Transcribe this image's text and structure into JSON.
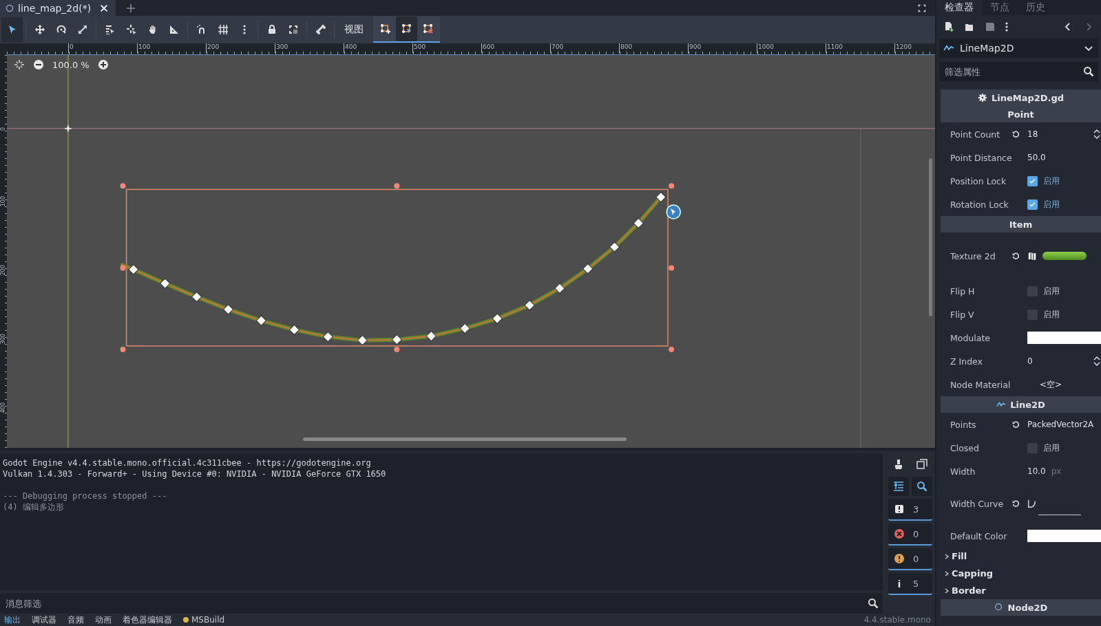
{
  "editor_tabs": [
    {
      "label": "line_map_2d(*)",
      "selected": true
    }
  ],
  "toolbar": {
    "tools": [
      {
        "selected": true
      },
      {
        "selected": false
      },
      {
        "selected": false
      },
      {
        "selected": false
      },
      {
        "selected": false
      },
      {
        "selected": false
      },
      {
        "selected": false
      },
      {
        "selected": false
      },
      {
        "selected": false
      },
      {
        "selected": false
      },
      {
        "selected": false
      },
      {
        "selected": false
      },
      {
        "selected": false
      },
      {
        "selected": false
      }
    ],
    "view_menu": "视图",
    "polygon_tools": [
      {
        "selected": false
      },
      {
        "selected": true
      },
      {
        "selected": false
      }
    ]
  },
  "ruler": {
    "horizontal": [
      "0",
      "100",
      "200",
      "300",
      "400",
      "500",
      "600",
      "700",
      "800",
      "900",
      "1000",
      "1100",
      "1200"
    ],
    "vertical": [
      "0",
      "100",
      "200",
      "300",
      "400"
    ]
  },
  "canvas": {
    "zoom": "100.0 %"
  },
  "output": {
    "lines": [
      {
        "kind": "normal",
        "text": "Godot Engine v4.4.stable.mono.official.4c311cbee - https://godotengine.org"
      },
      {
        "kind": "normal",
        "text": "Vulkan 1.4.303 - Forward+ - Using Device #0: NVIDIA - NVIDIA GeForce GTX 1650"
      },
      {
        "kind": "dim",
        "text": "--- Debugging process stopped ---"
      },
      {
        "kind": "dim",
        "text": "(4) 编辑多边形"
      }
    ],
    "counters": [
      {
        "kind": "message",
        "count": "3"
      },
      {
        "kind": "error",
        "count": "0"
      },
      {
        "kind": "warning",
        "count": "0"
      },
      {
        "kind": "info",
        "count": "5"
      }
    ],
    "filter": {
      "placeholder": "消息筛选"
    }
  },
  "bottom_tabs": [
    {
      "label": "输出",
      "selected": true
    },
    {
      "label": "调试器",
      "selected": false
    },
    {
      "label": "音频",
      "selected": false
    },
    {
      "label": "动画",
      "selected": false
    },
    {
      "label": "着色器编辑器",
      "selected": false
    },
    {
      "label": "MSBuild",
      "selected": false,
      "color": "#e0b44c"
    }
  ],
  "version": "4.4.stable.mono",
  "inspector": {
    "tabs": [
      {
        "label": "检查器",
        "selected": true
      },
      {
        "label": "节点",
        "selected": false
      },
      {
        "label": "历史",
        "selected": false
      }
    ],
    "node": {
      "name": "LineMap2D"
    },
    "filter": {
      "placeholder": "筛选属性"
    },
    "properties": [
      {
        "kind": "script",
        "title": "LineMap2D.gd"
      },
      {
        "kind": "category",
        "title": "Point"
      },
      {
        "kind": "spin",
        "label": "Point Count",
        "revert": true,
        "value": "18"
      },
      {
        "kind": "number",
        "label": "Point Distance",
        "revert": false,
        "value": "50.0"
      },
      {
        "kind": "check",
        "label": "Position Lock",
        "checked": true,
        "text": "启用"
      },
      {
        "kind": "check",
        "label": "Rotation Lock",
        "checked": true,
        "text": "启用"
      },
      {
        "kind": "category",
        "title": "Item"
      },
      {
        "kind": "texture",
        "label": "Texture 2d",
        "revert": true
      },
      {
        "kind": "check",
        "label": "Flip H",
        "checked": false,
        "text": "启用"
      },
      {
        "kind": "check",
        "label": "Flip V",
        "checked": false,
        "text": "启用"
      },
      {
        "kind": "color",
        "label": "Modulate",
        "color": "#ffffff"
      },
      {
        "kind": "spin",
        "label": "Z Index",
        "revert": false,
        "value": "0"
      },
      {
        "kind": "resource",
        "label": "Node Material",
        "value": "<空>"
      },
      {
        "kind": "line-class",
        "title": "Line2D"
      },
      {
        "kind": "number",
        "label": "Points",
        "revert": true,
        "value": "PackedVector2A"
      },
      {
        "kind": "check",
        "label": "Closed",
        "checked": false,
        "text": "启用"
      },
      {
        "kind": "unit",
        "label": "Width",
        "value": "10.0",
        "unit": "px"
      },
      {
        "kind": "curve",
        "label": "Width Curve",
        "revert": true
      },
      {
        "kind": "color",
        "label": "Default Color",
        "color": "#ffffff"
      },
      {
        "kind": "group",
        "title": "Fill"
      },
      {
        "kind": "group",
        "title": "Capping"
      },
      {
        "kind": "group",
        "title": "Border"
      },
      {
        "kind": "node-class",
        "title": "Node2D"
      }
    ]
  }
}
